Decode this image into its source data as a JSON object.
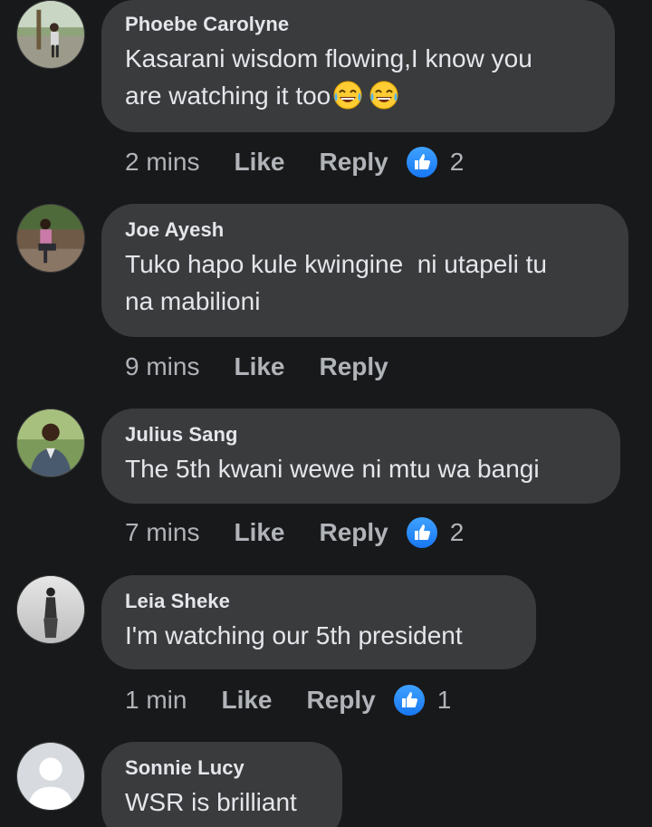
{
  "colors": {
    "background": "#18191a",
    "bubble": "#3a3b3c",
    "text": "#e4e6eb",
    "muted": "#b0b3b8",
    "like_blue": "#1877f2"
  },
  "comments": [
    {
      "author": "Phoebe Carolyne",
      "text_line1": "Kasarani wisdom flowing,I know you",
      "text_line2": "are watching it too",
      "emojis": [
        "laughing-crying-emoji",
        "laughing-crying-emoji"
      ],
      "time": "2 mins",
      "like_label": "Like",
      "reply_label": "Reply",
      "reaction_icon": "like-icon",
      "reaction_count": "2"
    },
    {
      "author": "Joe Ayesh",
      "text_line1": "Tuko hapo kule kwingine  ni utapeli tu",
      "text_line2": "na mabilioni",
      "time": "9 mins",
      "like_label": "Like",
      "reply_label": "Reply"
    },
    {
      "author": "Julius Sang",
      "text_line1": "The 5th kwani wewe ni mtu wa bangi",
      "time": "7 mins",
      "like_label": "Like",
      "reply_label": "Reply",
      "reaction_icon": "like-icon",
      "reaction_count": "2"
    },
    {
      "author": "Leia Sheke",
      "text_line1": "I'm watching our 5th president",
      "time": "1 min",
      "like_label": "Like",
      "reply_label": "Reply",
      "reaction_icon": "like-icon",
      "reaction_count": "1"
    },
    {
      "author": "Sonnie Lucy",
      "text_line1": "WSR is brilliant"
    }
  ]
}
